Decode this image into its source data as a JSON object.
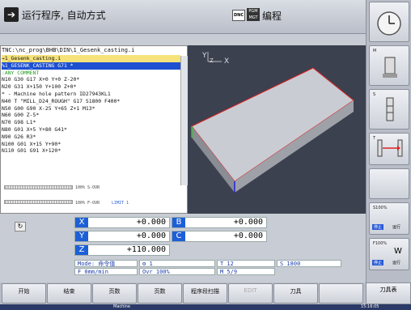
{
  "header": {
    "mode_title": "运行程序, 自动方式",
    "dnc_label": "DNC",
    "pgm_label": "PGM MGT",
    "program_title": "编程"
  },
  "program": {
    "path": "TNC:\\nc_prog\\BHB\\DIN\\1_Gesenk_casting.i",
    "lines": [
      {
        "text": "→1_Gesenk_casting.i",
        "style": "sel"
      },
      {
        "text": "%1_GESENK_CASTING G71 *",
        "style": "active"
      },
      {
        "text": ":ANY COMMENT",
        "style": "comment"
      },
      {
        "text": "N10 G30 G17 X+0 Y+0 Z-20*",
        "style": "normal"
      },
      {
        "text": "N20 G31 X+150 Y+100 Z+0*",
        "style": "normal"
      },
      {
        "text": "* - Machine hole pattern ID27943KL1",
        "style": "normal"
      },
      {
        "text": "N40 T \"MILL_D24_ROUGH\" G17 S1800 F400*",
        "style": "normal"
      },
      {
        "text": "N50 G00 G90 X-25 Y+65 Z+1 M13*",
        "style": "normal"
      },
      {
        "text": "N60 G00 Z-5*",
        "style": "normal"
      },
      {
        "text": "N70 G98 L1*",
        "style": "normal"
      },
      {
        "text": "N80 G01 X+5 Y+80 G41*",
        "style": "normal"
      },
      {
        "text": "N90 G26 R3*",
        "style": "normal"
      },
      {
        "text": "N100 G01 X+15 Y+90*",
        "style": "normal"
      },
      {
        "text": "N110 G01 G91 X+120*",
        "style": "normal"
      }
    ],
    "s_ovr_label": "100% S-OVR",
    "f_ovr_label": "100% F-OVR",
    "limit_label": "LIMIT 1"
  },
  "view": {
    "axis_y": "Y",
    "axis_z": "Z",
    "axis_x": "X"
  },
  "position": {
    "axes": [
      {
        "name": "X",
        "value": "+0.000"
      },
      {
        "name": "B",
        "value": "+0.000"
      },
      {
        "name": "Y",
        "value": "+0.000"
      },
      {
        "name": "C",
        "value": "+0.000"
      },
      {
        "name": "Z",
        "value": "+110.000"
      }
    ],
    "mode": "Mode: 命令值",
    "tool_num": "1",
    "t_field": "T 12",
    "s_field": "S 1800",
    "f_field": "F 0mm/min",
    "ovr_field": "Ovr 100%",
    "m_field": "M 5/9"
  },
  "right_softkeys": {
    "m": "M",
    "s": "S",
    "t": "T",
    "s100": "S100%",
    "f100": "F100%",
    "off": "停止",
    "on": "运行"
  },
  "bottom_softkeys": [
    "开始",
    "结束",
    "页数",
    "页数",
    "程序段扫描",
    "EDIT",
    "刀具",
    "",
    "刀具表"
  ],
  "taskbar": {
    "machine": "Machine",
    "time": "15:16:05"
  }
}
